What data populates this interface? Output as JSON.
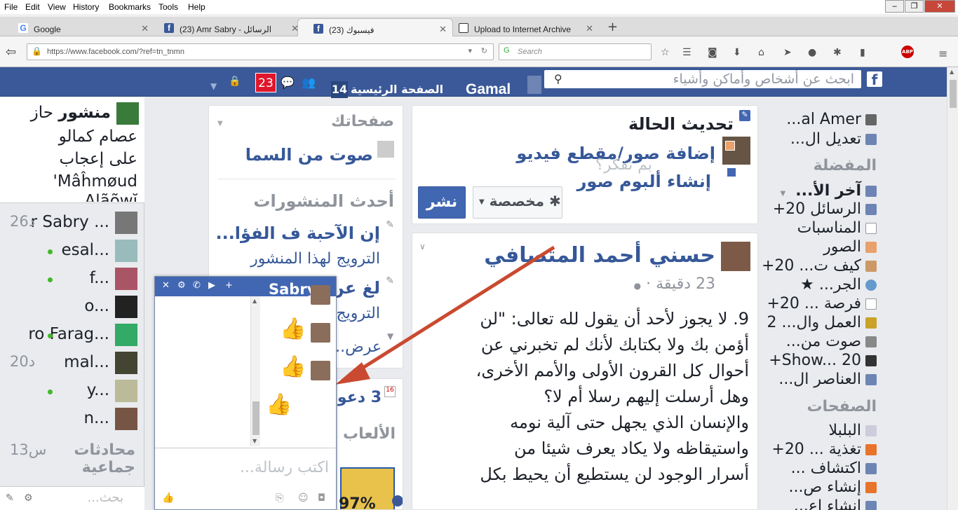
{
  "menubar": {
    "items": [
      "File",
      "Edit",
      "View",
      "History",
      "Bookmarks",
      "Tools",
      "Help"
    ]
  },
  "tabs": [
    {
      "title": "Google",
      "active": false,
      "favicon": "google-icon"
    },
    {
      "title": "(23) Amr Sabry - الرسائل",
      "active": false,
      "favicon": "facebook-icon"
    },
    {
      "title": "فيسبوك (23)",
      "active": true,
      "favicon": "facebook-icon"
    },
    {
      "title": "Upload to Internet Archive",
      "active": false,
      "favicon": "archive-icon"
    }
  ],
  "navbar": {
    "url": "https://www.facebook.com/?ref=tn_tnmn",
    "search_placeholder": "Search"
  },
  "fb_header": {
    "search_placeholder": "ابحث عن أشخاص وأماكن وأشياء",
    "user_name": "Gamal",
    "home_label": "الصفحة الرئيسية",
    "home_count": "14",
    "notif_count": "23"
  },
  "left_top": {
    "line1_name": "منشور",
    "line1_pre": "حاز",
    "line2": "عصام كمالو",
    "line3": "على إعجاب",
    "line4": "Mâĥmøud'",
    "line5": "Alãõwĭ"
  },
  "chat_list": [
    {
      "name": "r Sabry ...",
      "time": "26د",
      "online": false
    },
    {
      "name": "esal...",
      "time": "",
      "online": true
    },
    {
      "name": "f...",
      "time": "",
      "online": true
    },
    {
      "name": "o...",
      "time": "",
      "online": false
    },
    {
      "name": "ro Farag...",
      "time": "",
      "online": true
    },
    {
      "name": "mal...",
      "time": "20د",
      "online": false
    },
    {
      "name": "y...",
      "time": "",
      "online": true
    },
    {
      "name": "n...",
      "time": "",
      "online": false
    }
  ],
  "group_chats": {
    "label_l1": "محادثات",
    "label_l2": "جماعية",
    "time": "13س"
  },
  "chat_search_placeholder": "بحث...",
  "pages_card": {
    "title": "صفحاتك",
    "page_name": "صوت من السما",
    "recent_title": "أحدث المنشورات",
    "post1_title": "إن الآحبة ف الفؤا...",
    "post1_promote": "الترويج لهذا المنشور",
    "post2_title": "لغ عن...",
    "post2_promote": "الترويج...",
    "see_more": "عرض..."
  },
  "events_card": {
    "count_text": "3 دعو...",
    "games_title": "الألعاب",
    "game_percent": "97%"
  },
  "composer": {
    "status_title": "تحديث الحالة",
    "photo_video": "إضافة صور/مقطع فيديو",
    "album": "إنشاء ألبوم صور",
    "placeholder": "بم تفكر؟",
    "privacy": "مخصصة",
    "post_button": "نشر"
  },
  "post": {
    "author": "حسني أحمد المتصافي",
    "time": "23 دقيقة",
    "paragraphs": [
      "9. لا يجوز لأحد أن يقول لله تعالى: \"لن",
      "أؤمن بك ولا بكتابك لأنك لم تخبرني عن",
      "أحوال كل القرون الأولى والأمم الأخرى،",
      "وهل أرسلت إليهم رسلا أم لا؟",
      "والإنسان الذي يجهل حتى آلية نومه",
      "واستيقاظه ولا يكاد يعرف شيئا من",
      "أسرار الوجود لن يستطيع أن يحيط بكل"
    ]
  },
  "chat_window": {
    "title": "Sabry",
    "input_placeholder": "اكتب رسالة..."
  },
  "right_nav": {
    "user": "al Amer...",
    "edit": "تعديل ال...",
    "favorites_title": "المفضلة",
    "items": [
      {
        "label": "آخر الأ...",
        "count": "",
        "bold": true
      },
      {
        "label": "الرسائل",
        "count": "20+"
      },
      {
        "label": "المناسبات",
        "count": ""
      },
      {
        "label": "الصور",
        "count": ""
      },
      {
        "label": "كيف ت...",
        "count": "20+"
      },
      {
        "label": "الجر... ★",
        "count": ""
      },
      {
        "label": "فرصة ...",
        "count": "20+"
      },
      {
        "label": "العمل وال...",
        "count": "2"
      },
      {
        "label": "صوت من...",
        "count": ""
      },
      {
        "label": "Show...",
        "count": "20+"
      },
      {
        "label": "العناصر ال...",
        "count": ""
      }
    ],
    "pages_title": "الصفحات",
    "pages_items": [
      {
        "label": "البلبلا",
        "count": ""
      },
      {
        "label": "تغذية ...",
        "count": "20+"
      },
      {
        "label": "اكتشاف ...",
        "count": ""
      },
      {
        "label": "إنشاء ص...",
        "count": ""
      },
      {
        "label": "إنشاء إع...",
        "count": ""
      }
    ]
  }
}
